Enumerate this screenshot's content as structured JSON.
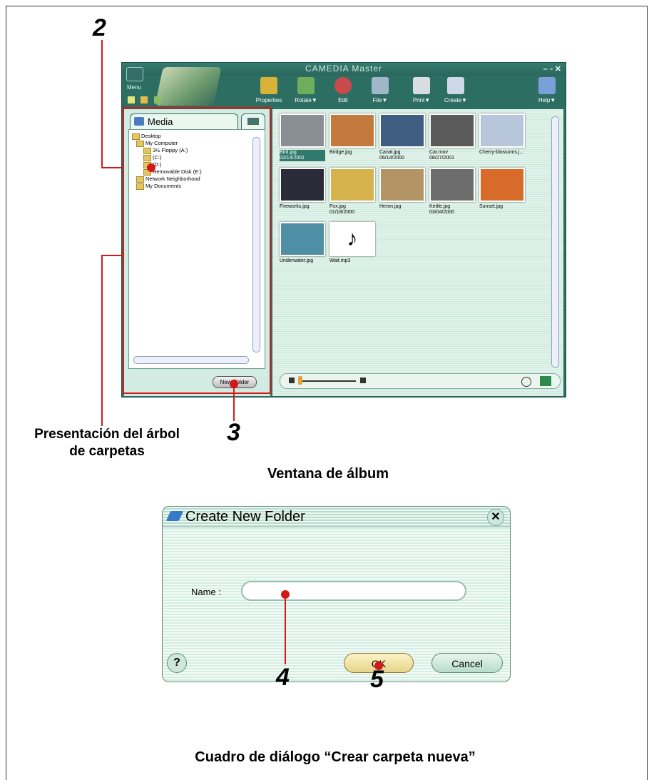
{
  "callouts": {
    "n2": "2",
    "n3": "3",
    "n4": "4",
    "n5": "5"
  },
  "captions": {
    "tree_line1": "Presentación del árbol",
    "tree_line2": "de carpetas",
    "album_window": "Ventana de álbum",
    "dialog": "Cuadro de diálogo “Crear carpeta nueva”"
  },
  "album": {
    "title": "CAMEDIA Master",
    "menu_label": "Menu",
    "window_controls": "– ▫ ✕",
    "toolbar": [
      {
        "label": "Properties",
        "icon": "properties-icon",
        "color": "#d8b33a"
      },
      {
        "label": "Rotate▼",
        "icon": "rotate-icon",
        "color": "#6fae5b"
      },
      {
        "label": "Edit",
        "icon": "edit-icon",
        "color": "#c84a4a"
      },
      {
        "label": "File▼",
        "icon": "file-icon",
        "color": "#9fb7c9"
      },
      {
        "label": "Print▼",
        "icon": "print-icon",
        "color": "#d7dde0"
      },
      {
        "label": "Create▼",
        "icon": "create-icon",
        "color": "#cdd9e6"
      },
      {
        "label": "Help▼",
        "icon": "help-icon",
        "color": "#7aa0d8"
      }
    ],
    "media_tab": "Media",
    "tree": [
      "Desktop",
      "My Computer",
      "3½ Floppy (A:)",
      "(C:)",
      "(D:)",
      "Removable Disk (E:)",
      "Network Neighborhood",
      "My Documents"
    ],
    "new_folder": "New Folder",
    "thumbnails": [
      {
        "name": "Bird.jpg",
        "date": "02/14/2001",
        "color": "#8a8f95",
        "selected": true
      },
      {
        "name": "Bridge.jpg",
        "date": "",
        "color": "#c47a3d"
      },
      {
        "name": "Canal.jpg",
        "date": "06/14/2000",
        "color": "#3f5e82"
      },
      {
        "name": "Car.mov",
        "date": "08/27/2001",
        "color": "#5a5a5a"
      },
      {
        "name": "Cherry-blossoms.j...",
        "date": "",
        "color": "#b7c6db"
      },
      {
        "name": "Fireworks.jpg",
        "date": "",
        "color": "#2a2a38"
      },
      {
        "name": "Fox.jpg",
        "date": "01/18/2000",
        "color": "#d6b24c"
      },
      {
        "name": "Heron.jpg",
        "date": "",
        "color": "#b39464"
      },
      {
        "name": "Kettle.jpg",
        "date": "03/04/2000",
        "color": "#6d6d6d"
      },
      {
        "name": "Sunset.jpg",
        "date": "",
        "color": "#d86a2a"
      },
      {
        "name": "Underwater.jpg",
        "date": "",
        "color": "#4f8fa5"
      },
      {
        "name": "Wait.mp3",
        "date": "",
        "color": "#ffffff"
      }
    ]
  },
  "dialog": {
    "title": "Create New Folder",
    "name_label": "Name :",
    "name_value": "",
    "ok": "OK",
    "cancel": "Cancel",
    "help": "?",
    "close": "✕"
  }
}
